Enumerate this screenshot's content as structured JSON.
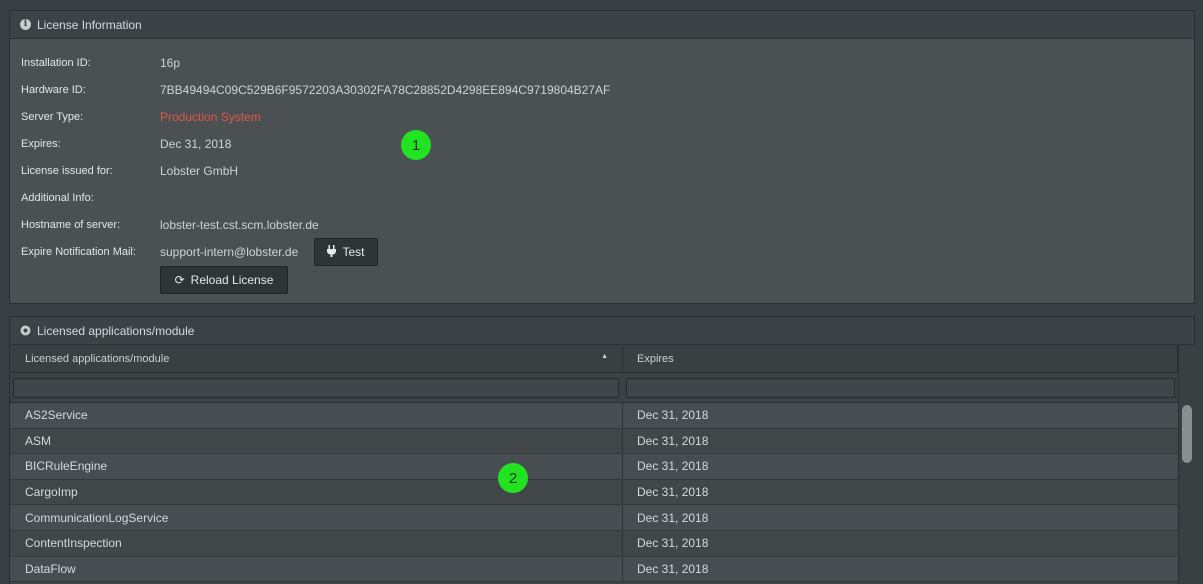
{
  "license_panel": {
    "title": "License Information",
    "icon": "info-icon",
    "rows": [
      {
        "label": "Installation ID:",
        "value": "16p"
      },
      {
        "label": "Hardware ID:",
        "value": "7BB49494C09C529B6F9572203A30302FA78C28852D4298EE894C9719804B27AF"
      },
      {
        "label": "Server Type:",
        "value": "Production System",
        "color": "#e0554a"
      },
      {
        "label": "Expires:",
        "value": "Dec 31, 2018"
      },
      {
        "label": "License issued for:",
        "value": "Lobster GmbH"
      },
      {
        "label": "Additional Info:",
        "value": ""
      },
      {
        "label": "Hostname of server:",
        "value": "lobster-test.cst.scm.lobster.de"
      },
      {
        "label": "Expire Notification Mail:",
        "value": "support-intern@lobster.de"
      }
    ],
    "test_label": "Test",
    "test_icon": "plug-icon",
    "reload_label": "Reload License",
    "reload_icon": "refresh-icon"
  },
  "markers": {
    "one": "1",
    "two": "2"
  },
  "modules_panel": {
    "title": "Licensed applications/module",
    "icon": "puzzle-icon",
    "columns": [
      "Licensed applications/module",
      "Expires"
    ],
    "sort": "ascending",
    "filter1": "",
    "filter2": "",
    "rows": [
      {
        "name": "AS2Service",
        "expires": "Dec 31, 2018"
      },
      {
        "name": "ASM",
        "expires": "Dec 31, 2018"
      },
      {
        "name": "BICRuleEngine",
        "expires": "Dec 31, 2018"
      },
      {
        "name": "CargoImp",
        "expires": "Dec 31, 2018"
      },
      {
        "name": "CommunicationLogService",
        "expires": "Dec 31, 2018"
      },
      {
        "name": "ContentInspection",
        "expires": "Dec 31, 2018"
      },
      {
        "name": "DataFlow",
        "expires": "Dec 31, 2018"
      }
    ]
  }
}
